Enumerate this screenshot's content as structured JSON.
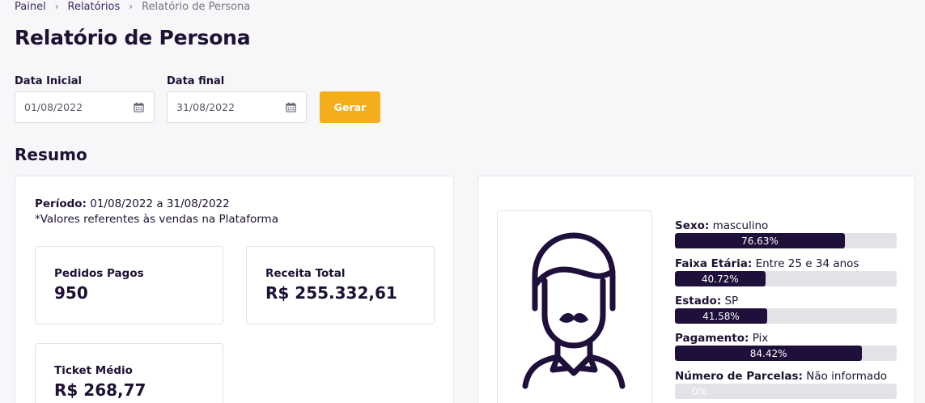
{
  "breadcrumb": {
    "items": [
      "Painel",
      "Relatórios",
      "Relatório de Persona"
    ]
  },
  "page_title": "Relatório de Persona",
  "filters": {
    "start_label": "Data Inicial",
    "start_value": "01/08/2022",
    "end_label": "Data final",
    "end_value": "31/08/2022",
    "generate_label": "Gerar"
  },
  "section_title": "Resumo",
  "summary": {
    "period_label": "Período:",
    "period_value": "01/08/2022 a 31/08/2022",
    "note": "*Valores referentes às vendas na Plataforma",
    "metrics": [
      {
        "label": "Pedidos Pagos",
        "value": "950"
      },
      {
        "label": "Receita Total",
        "value": "R$ 255.332,61"
      },
      {
        "label": "Ticket Médio",
        "value": "R$ 268,77"
      }
    ]
  },
  "persona": {
    "avatar_icon": "persona-avatar-icon",
    "stats": [
      {
        "label": "Sexo:",
        "value": "masculino",
        "percent": 76.63,
        "percent_text": "76.63%"
      },
      {
        "label": "Faixa Etária:",
        "value": "Entre 25 e 34 anos",
        "percent": 40.72,
        "percent_text": "40.72%"
      },
      {
        "label": "Estado:",
        "value": "SP",
        "percent": 41.58,
        "percent_text": "41.58%"
      },
      {
        "label": "Pagamento:",
        "value": "Pix",
        "percent": 84.42,
        "percent_text": "84.42%"
      },
      {
        "label": "Número de Parcelas:",
        "value": "Não informado",
        "percent": 0,
        "percent_text": "0%"
      }
    ]
  },
  "colors": {
    "accent": "#f5ae1b",
    "bar_fill": "#1e0f3b",
    "bar_track": "#e3e2e6",
    "text_dark": "#1e1133"
  }
}
